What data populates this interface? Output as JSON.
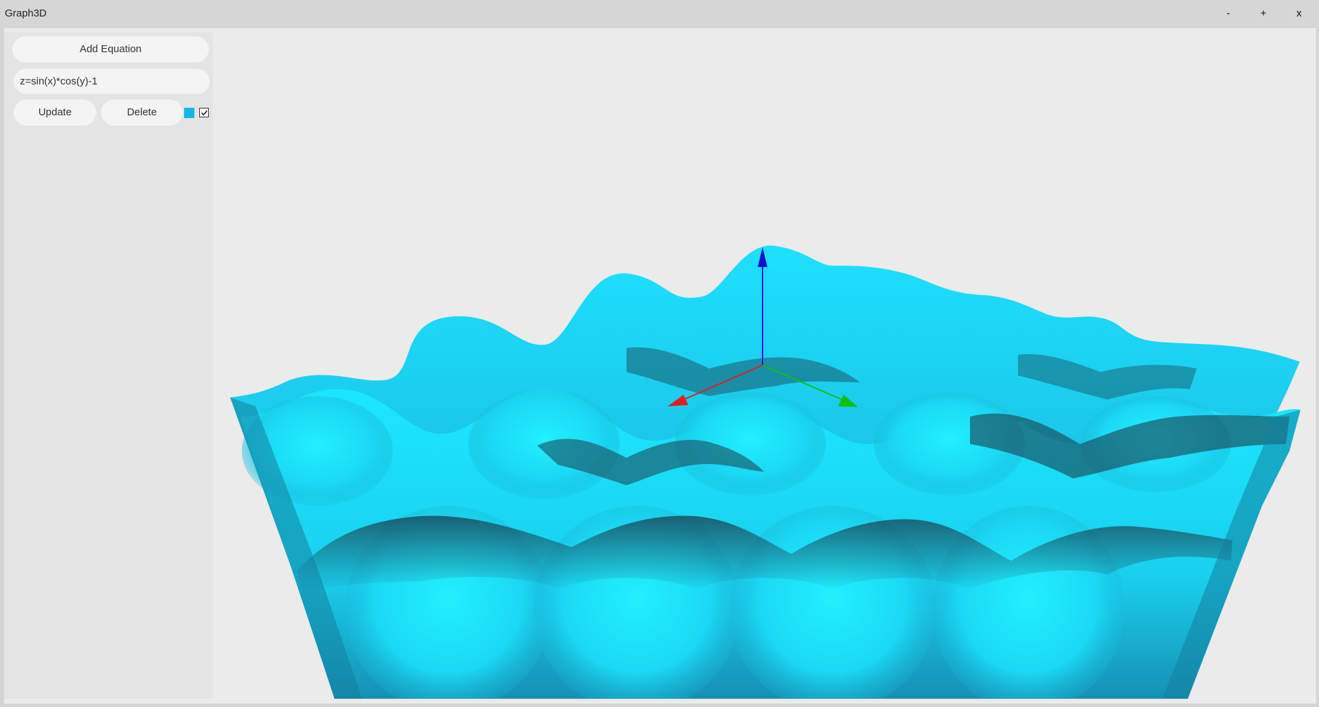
{
  "window": {
    "title": "Graph3D",
    "minimize_label": "-",
    "maximize_label": "+",
    "close_label": "x"
  },
  "sidebar": {
    "add_equation_label": "Add Equation",
    "equations": [
      {
        "value": "z=sin(x)*cos(y)-1",
        "update_label": "Update",
        "delete_label": "Delete",
        "color": "#13b7e6",
        "visible": true
      }
    ]
  },
  "plot": {
    "surface_color": "#1ee8ff",
    "surface_shadow_color": "#1a3f4d",
    "axis_colors": {
      "x": "#e02020",
      "y": "#10c010",
      "z": "#1010d0"
    }
  }
}
